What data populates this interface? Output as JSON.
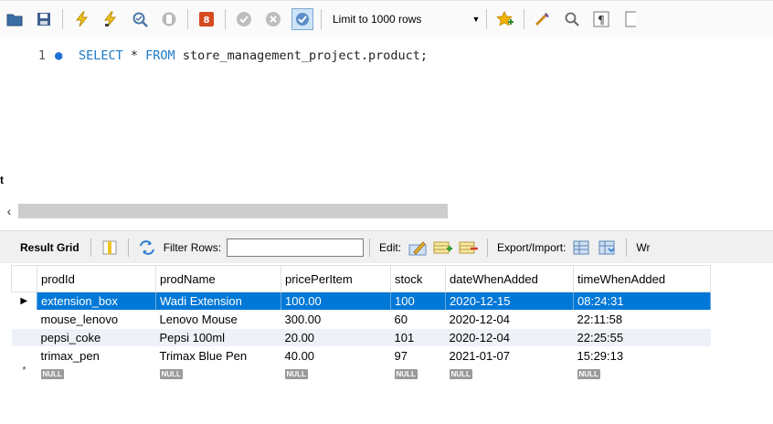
{
  "toolbar": {
    "limit_label": "Limit to 1000 rows",
    "icons": [
      "open-folder-icon",
      "save-icon",
      "execute-icon",
      "execute-current-icon",
      "explain-icon",
      "stop-icon",
      "toggle-errors-icon",
      "commit-icon",
      "rollback-icon",
      "autocommit-icon",
      "favorite-icon",
      "beautify-icon",
      "find-icon",
      "invisible-chars-icon",
      "wrap-icon"
    ]
  },
  "editor": {
    "line_number": "1",
    "kw_select": "SELECT",
    "star": " * ",
    "kw_from": "FROM",
    "rest": " store_management_project.product;",
    "left_fragment": "t"
  },
  "result_bar": {
    "result_grid_label": "Result Grid",
    "filter_rows_label": "Filter Rows:",
    "filter_value": "",
    "edit_label": "Edit:",
    "export_label": "Export/Import:",
    "wrap_fragment": "Wr"
  },
  "grid": {
    "columns": [
      "prodId",
      "prodName",
      "pricePerItem",
      "stock",
      "dateWhenAdded",
      "timeWhenAdded"
    ],
    "rows": [
      [
        "extension_box",
        "Wadi Extension",
        "100.00",
        "100",
        "2020-12-15",
        "08:24:31"
      ],
      [
        "mouse_lenovo",
        "Lenovo Mouse",
        "300.00",
        "60",
        "2020-12-04",
        "22:11:58"
      ],
      [
        "pepsi_coke",
        "Pepsi 100ml",
        "20.00",
        "101",
        "2020-12-04",
        "22:25:55"
      ],
      [
        "trimax_pen",
        "Trimax Blue Pen",
        "40.00",
        "97",
        "2021-01-07",
        "15:29:13"
      ]
    ],
    "null_label": "NULL",
    "new_row_marker": "*"
  },
  "colors": {
    "selection": "#0078d7",
    "keyword": "#1d79c7",
    "alt_row": "#eef2f8"
  }
}
